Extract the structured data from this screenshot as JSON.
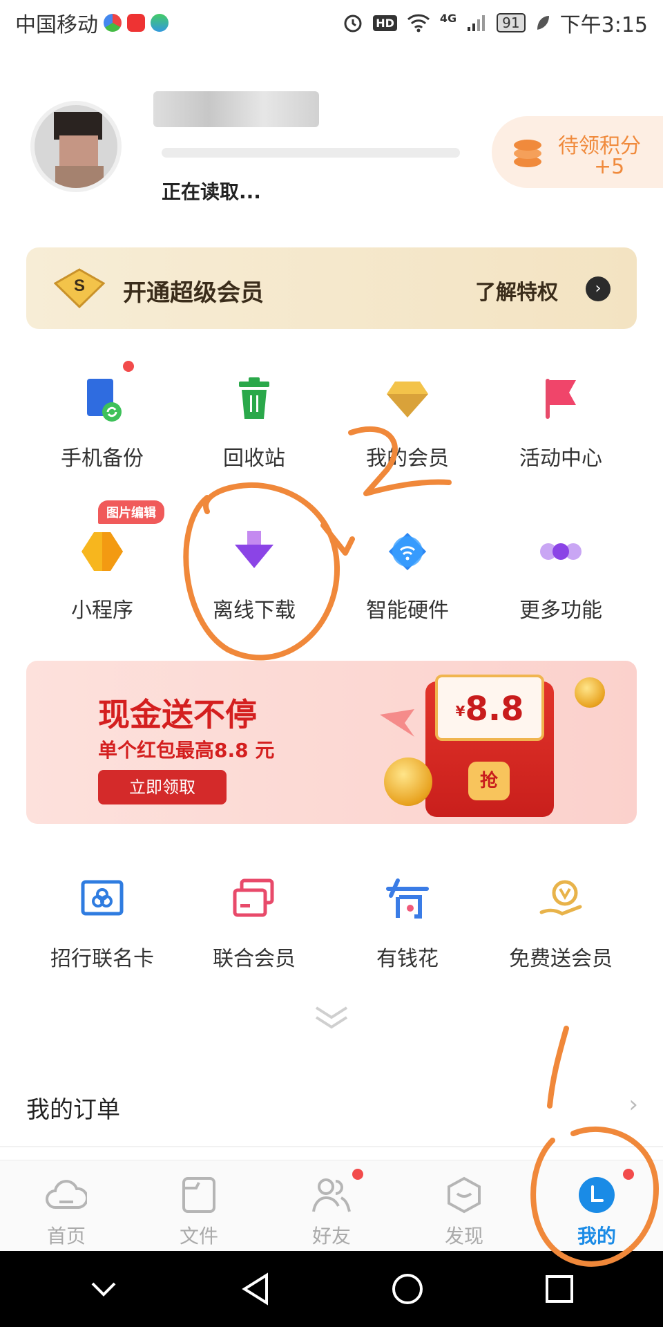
{
  "status_bar": {
    "carrier": "中国移动",
    "network": "4G",
    "hd": "HD",
    "battery": "91",
    "time": "下午3:15"
  },
  "profile": {
    "status_text": "正在读取...",
    "points_label": "待领积分",
    "points_value": "+5"
  },
  "vip_banner": {
    "badge": "S",
    "title": "开通超级会员",
    "link": "了解特权"
  },
  "features": [
    {
      "label": "手机备份",
      "icon": "phone-backup-icon"
    },
    {
      "label": "回收站",
      "icon": "trash-icon"
    },
    {
      "label": "我的会员",
      "icon": "diamond-icon"
    },
    {
      "label": "活动中心",
      "icon": "flag-icon"
    },
    {
      "label": "小程序",
      "icon": "mini-program-icon"
    },
    {
      "label": "离线下载",
      "icon": "download-arrow-icon"
    },
    {
      "label": "智能硬件",
      "icon": "smart-device-icon"
    },
    {
      "label": "更多功能",
      "icon": "more-dots-icon"
    }
  ],
  "mini_program_badge": "图片编辑",
  "promo": {
    "title": "现金送不停",
    "subtitle": "单个红包最高8.8 元",
    "button": "立即领取",
    "currency": "¥",
    "amount": "8.8",
    "seal": "抢"
  },
  "services": [
    {
      "label": "招行联名卡",
      "icon": "bank-card-icon"
    },
    {
      "label": "联合会员",
      "icon": "cards-icon"
    },
    {
      "label": "有钱花",
      "icon": "money-icon"
    },
    {
      "label": "免费送会员",
      "icon": "gift-vip-icon"
    }
  ],
  "orders": {
    "label": "我的订单"
  },
  "tabs": [
    {
      "label": "首页",
      "icon": "cloud-icon"
    },
    {
      "label": "文件",
      "icon": "folder-icon"
    },
    {
      "label": "好友",
      "icon": "friends-icon"
    },
    {
      "label": "发现",
      "icon": "discover-icon"
    },
    {
      "label": "我的",
      "icon": "profile-icon"
    }
  ],
  "colors": {
    "accent": "#1a8be6",
    "promo_red": "#d41f1f",
    "annotation_orange": "#f0883a"
  },
  "annotations": [
    "1",
    "2"
  ]
}
